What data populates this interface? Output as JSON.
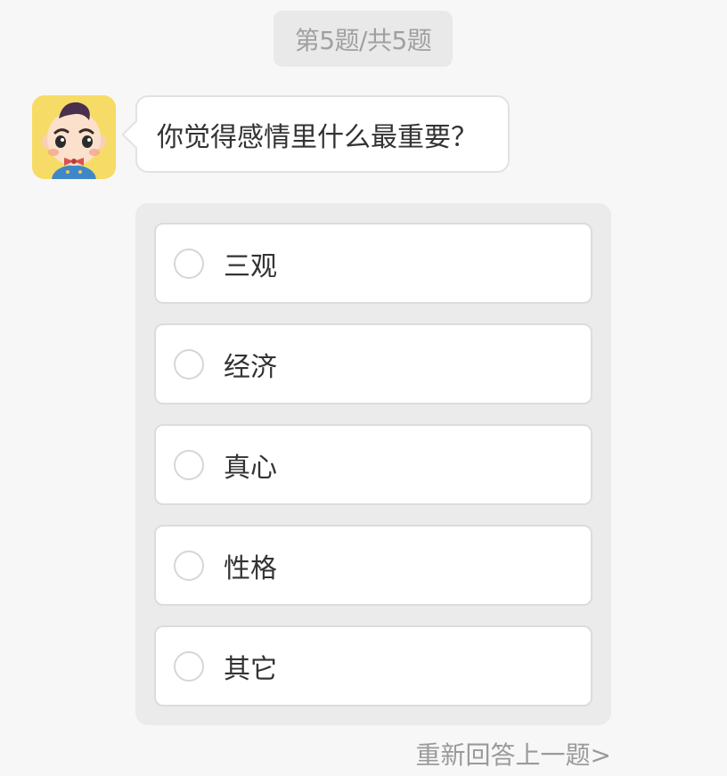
{
  "progress": {
    "label": "第5题/共5题"
  },
  "question": {
    "text": "你觉得感情里什么最重要？"
  },
  "options": [
    {
      "label": "三观"
    },
    {
      "label": "经济"
    },
    {
      "label": "真心"
    },
    {
      "label": "性格"
    },
    {
      "label": "其它"
    }
  ],
  "footer": {
    "redo_label": "重新回答上一题>"
  },
  "colors": {
    "page_bg": "#f7f7f7",
    "panel_bg": "#ebebeb",
    "avatar_bg": "#f6dc66",
    "text": "#333333",
    "muted": "#9a9a9a"
  },
  "icons": {
    "avatar": "cartoon-boy-avatar",
    "option_marker": "radio-circle-icon"
  }
}
